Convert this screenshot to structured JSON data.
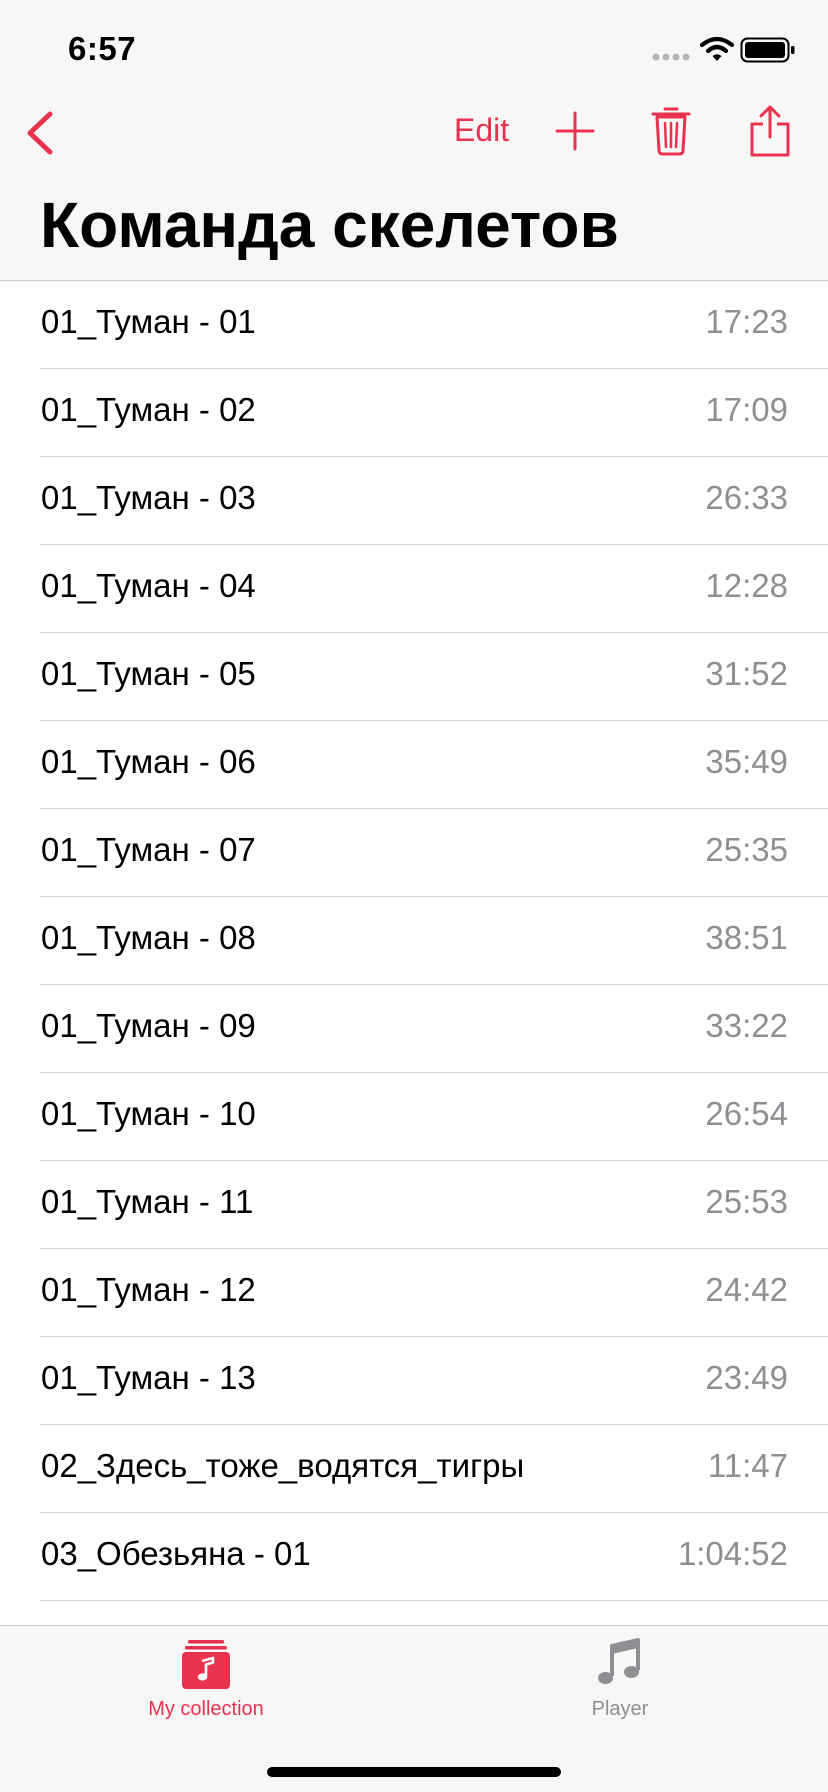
{
  "status_bar": {
    "time": "6:57"
  },
  "nav": {
    "edit_label": "Edit",
    "back_icon": "chevron-left-icon",
    "add_icon": "plus-icon",
    "trash_icon": "trash-icon",
    "share_icon": "share-icon"
  },
  "title": "Команда скелетов",
  "tracks": [
    {
      "title": "01_Туман - 01",
      "duration": "17:23"
    },
    {
      "title": "01_Туман - 02",
      "duration": "17:09"
    },
    {
      "title": "01_Туман - 03",
      "duration": "26:33"
    },
    {
      "title": "01_Туман - 04",
      "duration": "12:28"
    },
    {
      "title": "01_Туман - 05",
      "duration": "31:52"
    },
    {
      "title": "01_Туман - 06",
      "duration": "35:49"
    },
    {
      "title": "01_Туман - 07",
      "duration": "25:35"
    },
    {
      "title": "01_Туман - 08",
      "duration": "38:51"
    },
    {
      "title": "01_Туман - 09",
      "duration": "33:22"
    },
    {
      "title": "01_Туман - 10",
      "duration": "26:54"
    },
    {
      "title": "01_Туман - 11",
      "duration": "25:53"
    },
    {
      "title": "01_Туман - 12",
      "duration": "24:42"
    },
    {
      "title": "01_Туман - 13",
      "duration": "23:49"
    },
    {
      "title": "02_Здесь_тоже_водятся_тигры",
      "duration": "11:47"
    },
    {
      "title": "03_Обезьяна - 01",
      "duration": "1:04:52"
    }
  ],
  "tab_bar": {
    "collection_label": "My collection",
    "player_label": "Player",
    "collection_icon": "music-collection-icon",
    "player_icon": "music-note-icon",
    "active_tab": "collection"
  },
  "colors": {
    "accent": "#e8334f",
    "tab_active": "#e8334f",
    "tab_inactive": "#8e8e93",
    "secondary_text": "#8e8e93"
  }
}
